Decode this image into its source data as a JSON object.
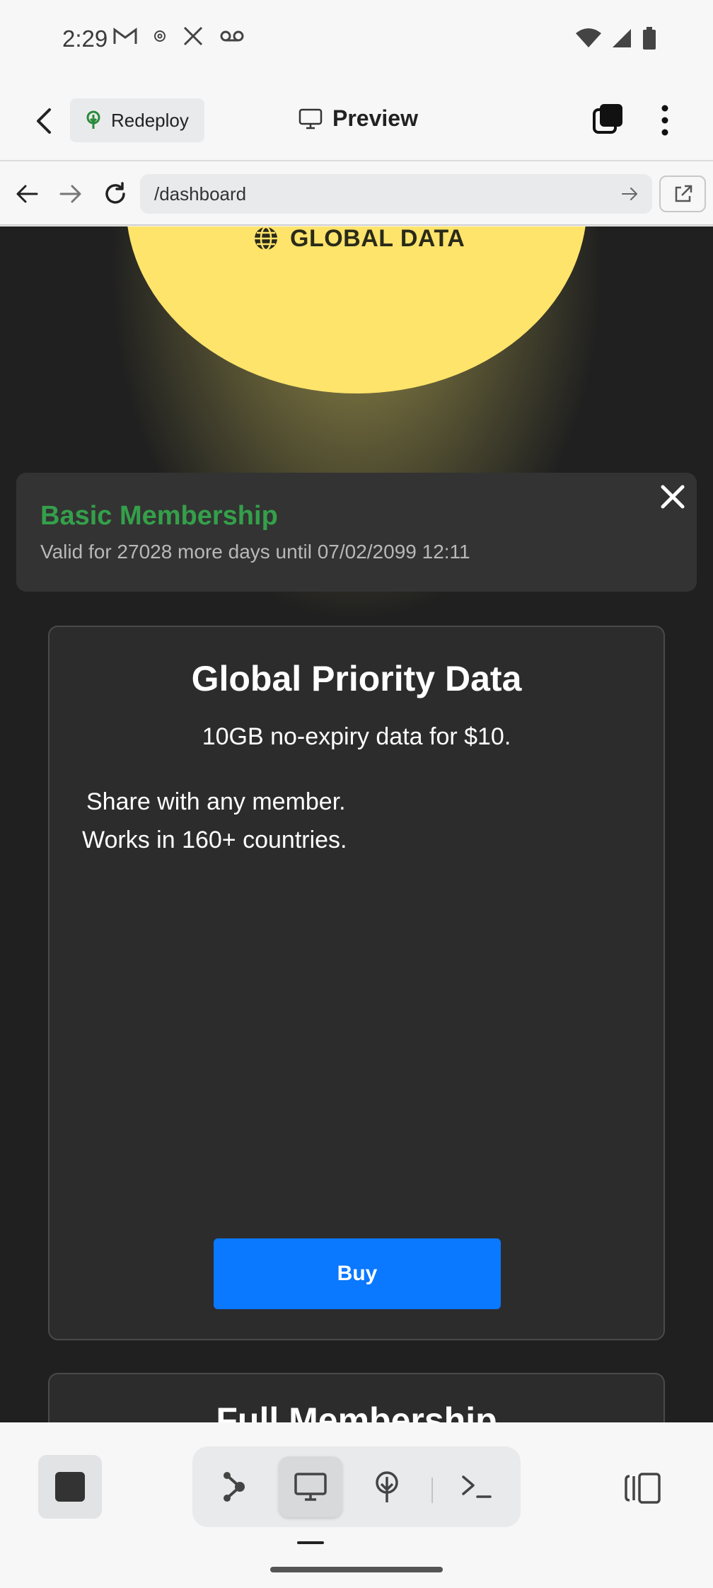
{
  "status_bar": {
    "time": "2:29",
    "left_icons": [
      "gmail-icon",
      "at-sign-icon",
      "x-icon",
      "voicemail-icon"
    ],
    "right_icons": [
      "wifi-icon",
      "signal-icon",
      "battery-icon"
    ]
  },
  "app_bar": {
    "redeploy_label": "Redeploy",
    "preview_label": "Preview"
  },
  "browser": {
    "url": "/dashboard"
  },
  "hero": {
    "label": "GLOBAL DATA"
  },
  "membership": {
    "title": "Basic Membership",
    "valid_text": "Valid for 27028 more days until 07/02/2099 12:11"
  },
  "data_card": {
    "title": "Global Priority Data",
    "subtitle": "10GB no-expiry data for $10.",
    "line1": "Share with any member.",
    "line2": "Works in 160+ countries.",
    "button_label": "Buy"
  },
  "next_card": {
    "title": "Full Membership"
  },
  "colors": {
    "accent_green": "#34a04a",
    "buy_blue": "#0a78ff",
    "sun_yellow": "#ffe46b",
    "page_dark": "#202020"
  }
}
